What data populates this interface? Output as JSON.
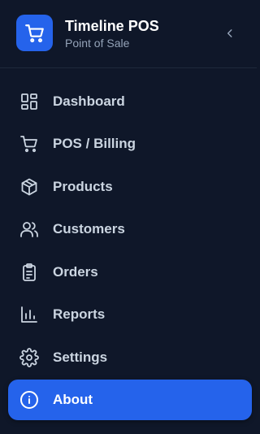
{
  "app": {
    "title": "Timeline POS",
    "subtitle": "Point of Sale"
  },
  "colors": {
    "background": "#0f1729",
    "accent": "#2563eb",
    "text": "#cbd5e1",
    "muted": "#94a3b8"
  },
  "nav": {
    "items": [
      {
        "label": "Dashboard",
        "icon": "dashboard-grid-icon",
        "active": false
      },
      {
        "label": "POS / Billing",
        "icon": "cart-icon",
        "active": false
      },
      {
        "label": "Products",
        "icon": "box-icon",
        "active": false
      },
      {
        "label": "Customers",
        "icon": "users-icon",
        "active": false
      },
      {
        "label": "Orders",
        "icon": "clipboard-icon",
        "active": false
      },
      {
        "label": "Reports",
        "icon": "bar-chart-icon",
        "active": false
      },
      {
        "label": "Settings",
        "icon": "gear-icon",
        "active": false
      },
      {
        "label": "About",
        "icon": "info-icon",
        "active": true
      }
    ]
  }
}
